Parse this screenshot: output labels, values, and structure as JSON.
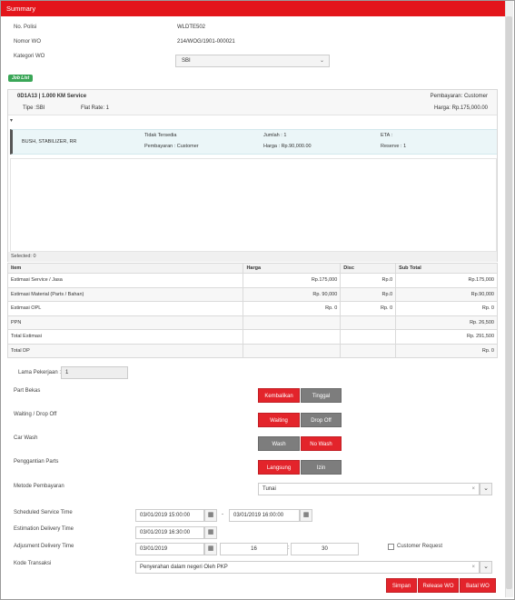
{
  "header": {
    "title": "Summary"
  },
  "info": {
    "no_polisi_label": "No. Polisi",
    "no_polisi_value": "WLDTE502",
    "nomor_wo_label": "Nomor WO",
    "nomor_wo_value": "214/WOG/1901-000021",
    "kategori_wo_label": "Kategori WO",
    "kategori_wo_value": "SBI"
  },
  "job_list_badge": "Job List",
  "job": {
    "title": "0D1A13 | 1.000 KM Service",
    "pembayaran": "Pembayaran: Customer",
    "tipe": "Tipe :SBI",
    "flat_rate": "Flat Rate: 1",
    "harga": "Harga: Rp.175,000.00",
    "part": {
      "name": "BUSH, STABILIZER, RR",
      "status": "Tidak Tersedia",
      "pembayaran": "Pembayaran : Customer",
      "jumlah": "Jumlah : 1",
      "harga": "Harga : Rp.90,000.00",
      "eta": "ETA :",
      "reserve": "Reserve : 1"
    },
    "selected": "Selected: 0"
  },
  "estimate_table": {
    "headers": [
      "Item",
      "Harga",
      "Disc",
      "Sub Total"
    ],
    "rows": [
      [
        "Estimasi Service / Jasa",
        "Rp.175,000",
        "Rp.0",
        "Rp.175,000"
      ],
      [
        "Estimasi Material (Parts / Bahan)",
        "Rp. 90,000",
        "Rp.0",
        "Rp.90,000"
      ],
      [
        "Estimasi OPL",
        "Rp. 0",
        "Rp. 0",
        "Rp. 0"
      ],
      [
        "PPN",
        "",
        "",
        "Rp. 26,500"
      ],
      [
        "Total Estimasi",
        "",
        "",
        "Rp. 291,500"
      ],
      [
        "Total DP",
        "",
        "",
        "Rp. 0"
      ]
    ]
  },
  "form": {
    "lama_pekerjaan_label": "Lama Pekerjaan :",
    "lama_pekerjaan_value": "1",
    "part_bekas_label": "Part Bekas",
    "part_bekas_options": [
      "Kembalikan",
      "Tinggal"
    ],
    "waiting_label": "Waiting / Drop Off",
    "waiting_options": [
      "Waiting",
      "Drop Off"
    ],
    "car_wash_label": "Car Wash",
    "car_wash_options": [
      "Wash",
      "No Wash"
    ],
    "penggantian_label": "Penggantian Parts",
    "penggantian_options": [
      "Langsung",
      "Izin"
    ],
    "metode_label": "Metode Pembayaran",
    "metode_value": "Tunai",
    "scheduled_label": "Scheduled Service Time",
    "scheduled_start": "03/01/2019 15:00:00",
    "scheduled_sep": "-",
    "scheduled_end": "03/01/2019 16:00:00",
    "estimation_label": "Estimation Delivery Time",
    "estimation_value": "03/01/2019 16:30:00",
    "adjusment_label": "Adjusment Delivery Time",
    "adjusment_date": "03/01/2019",
    "adjusment_hour": "16",
    "adjusment_sep": ":",
    "adjusment_minute": "30",
    "customer_request_label": "Customer Request",
    "kode_label": "Kode Transaksi",
    "kode_value": "Penyerahan dalam negeri Oleh PKP"
  },
  "actions": {
    "simpan": "Simpan",
    "release": "Release WO",
    "batal": "Batal WO"
  },
  "colors": {
    "accent_red": "#e3151b",
    "button_gray": "#7d7d7d",
    "badge_green": "#3aa657"
  }
}
